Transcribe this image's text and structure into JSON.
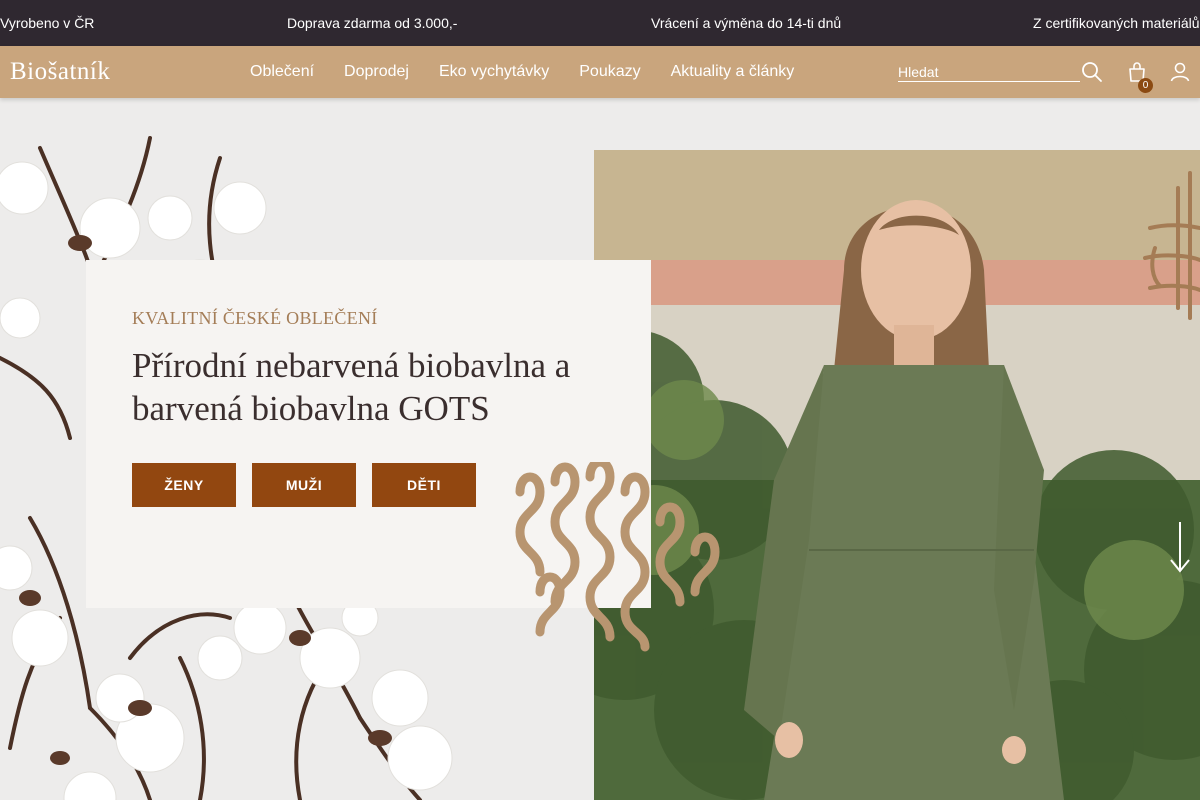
{
  "topbar": {
    "items": [
      "Vyrobeno v ČR",
      "Doprava zdarma od 3.000,-",
      "Vrácení a výměna do 14-ti dnů",
      "Z certifikovaných materiálů"
    ]
  },
  "header": {
    "logo": "Biošatník",
    "nav": [
      "Oblečení",
      "Doprodej",
      "Eko vychytávky",
      "Poukazy",
      "Aktuality a články"
    ],
    "search_placeholder": "Hledat",
    "cart_count": "0",
    "icons": [
      "search-icon",
      "cart-icon",
      "user-icon"
    ]
  },
  "hero": {
    "kicker": "KVALITNÍ ČESKÉ OBLEČENÍ",
    "title": "Přírodní nebarvená biobavlna a barvená biobavlna GOTS",
    "buttons": [
      "ŽENY",
      "MUŽI",
      "DĚTI"
    ],
    "scroll_icon": "arrow-down-icon"
  },
  "colors": {
    "topbar_bg": "#2f2830",
    "header_bg": "#c9a57d",
    "accent": "#924710",
    "kicker": "#a47d57"
  }
}
